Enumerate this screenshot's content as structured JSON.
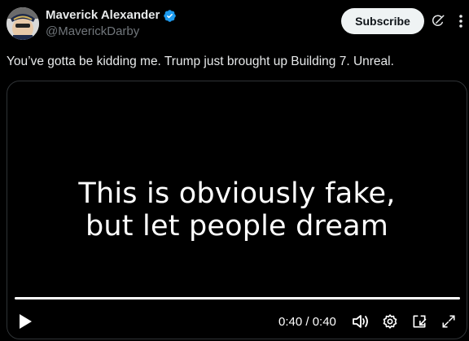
{
  "author": {
    "display_name": "Maverick Alexander",
    "handle": "@MaverickDarby",
    "verified": true,
    "verified_color": "#1d9bf0"
  },
  "header_actions": {
    "subscribe_label": "Subscribe",
    "grok_icon": "grok-icon",
    "more_icon": "more-icon"
  },
  "post": {
    "text": "You’ve gotta be kidding me. Trump just brought up Building 7. Unreal."
  },
  "video": {
    "caption_line1": "This is obviously fake,",
    "caption_line2": "but let people dream",
    "progress": 1.0,
    "time_display": "0:40 / 0:40",
    "controls": [
      "play-icon",
      "volume-icon",
      "settings-icon",
      "pop-out-icon",
      "fullscreen-icon"
    ]
  },
  "colors": {
    "background": "#000000",
    "text_primary": "#e7e9ea",
    "text_secondary": "#71767b",
    "button_bg": "#eff3f4"
  }
}
